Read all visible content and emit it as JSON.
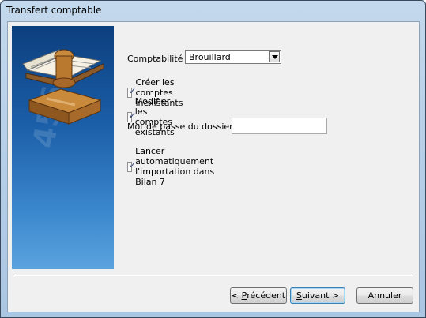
{
  "window": {
    "title": "Transfert comptable"
  },
  "banner": {
    "digits": "456",
    "icon": "book-stamp-icon"
  },
  "form": {
    "comptabilite_label": "Comptabilité :",
    "comptabilite_value": "Brouillard",
    "creer_label": "Créer les comptes inexistants",
    "creer_checked": true,
    "modifier_label": "Modifier les comptes existants",
    "modifier_checked": true,
    "password_label": "Mot de passe du dossier :",
    "password_value": "",
    "lancer_label": "Lancer automatiquement l'importation dans Bilan 7",
    "lancer_checked": true
  },
  "buttons": {
    "back_prefix": "< ",
    "back_accel": "P",
    "back_rest": "récédent",
    "next_accel": "S",
    "next_rest": "uivant >",
    "cancel": "Annuler"
  }
}
